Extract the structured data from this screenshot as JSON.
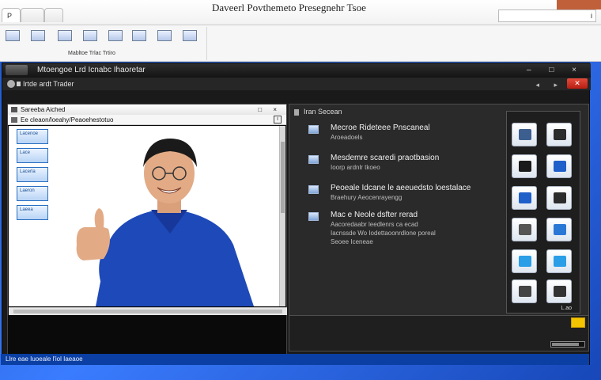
{
  "titlebar": {
    "title": "Daveerl Povthemeto Presegnehr Tsoe",
    "tabs": [
      "P",
      "",
      ""
    ],
    "right_box": "i"
  },
  "ribbon": {
    "buttons": [
      "",
      "",
      "",
      "",
      "",
      "",
      "",
      "",
      ""
    ],
    "caption": "Mabltoe  Trlac  Trtiro"
  },
  "main": {
    "header_title": "Mtoengoe  Lrd Icnabc Ihaoretar",
    "window_controls": "– □ ×",
    "toolbar_text": "Irtde   ardt  Trader",
    "toolbar_controls": "◂ ▸",
    "close_label": "✕"
  },
  "left_panel": {
    "title": "Sareeba Aiched",
    "title_controls": "□ ×",
    "path": "Ee cleaon/loeahy/Peaoehestotuo",
    "path_ctrl": "i",
    "thumbnails": [
      "Lacenoe",
      "Lace",
      "Lacerla",
      "Laeron",
      "Laeea"
    ]
  },
  "right_panel": {
    "title": "Iran Secean",
    "features": [
      {
        "heading": "Mecroe Rideteee Pnscaneal",
        "sub": [
          "Aroeadoels"
        ]
      },
      {
        "heading": "Mesdemre scaredi praotbasion",
        "sub": [
          "Ioorp ardnlr tkoeo"
        ]
      },
      {
        "heading": "Peoeale Idcane le aeeuedsto loestalace",
        "sub": [
          "Braehury Aeocenrayengg"
        ]
      },
      {
        "heading": "Mac e Neole dsfter rerad",
        "sub": [
          "Aacoredaabr leedlenrs ca ecad",
          "Iacnssde  Wo Iodettaoonrdlone poreal",
          "Seoee Iceneae"
        ]
      }
    ],
    "grid_caption": "L.ao",
    "icon_colors": [
      "#3d5f8f",
      "#2c2c2c",
      "#1a1a1a",
      "#1f5fc9",
      "#1f5fc9",
      "#2c2c2c",
      "#555555",
      "#2a78d6",
      "#2a9ee6",
      "#2a9ee6",
      "#444444",
      "#333333"
    ],
    "progress": 0.85
  },
  "statusbar": {
    "text": "Llre eae  Iuoeale  l'iol Iaeaoe"
  }
}
